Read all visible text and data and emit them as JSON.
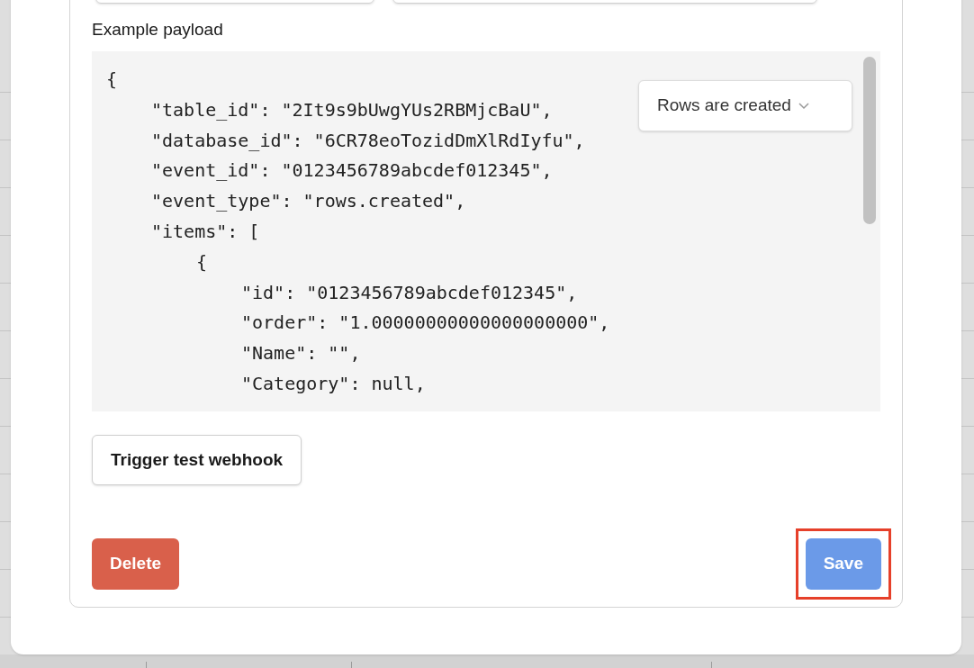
{
  "payload_section": {
    "title": "Example payload",
    "code_lines": [
      {
        "text": "{",
        "children": [
          {
            "text": "\"table_id\": \"2It9s9bUwgYUs2RBMjcBaU\","
          },
          {
            "text": "\"database_id\": \"6CR78eoTozidDmXlRdIyfu\","
          },
          {
            "text": "\"event_id\": \"0123456789abcdef012345\","
          },
          {
            "text": "\"event_type\": \"rows.created\","
          },
          {
            "text": "\"items\": [",
            "children": [
              {
                "text": "{",
                "children": [
                  {
                    "text": "\"id\": \"0123456789abcdef012345\","
                  },
                  {
                    "text": "\"order\": \"1.00000000000000000000\","
                  },
                  {
                    "text": "\"Name\": \"\","
                  },
                  {
                    "text": "\"Category\": null,"
                  }
                ]
              }
            ]
          }
        ]
      }
    ],
    "event_select": {
      "value": "Rows are created"
    }
  },
  "trigger_button": "Trigger test webhook",
  "delete_button": "Delete",
  "save_button": {
    "label": "Save",
    "highlighted": true
  }
}
